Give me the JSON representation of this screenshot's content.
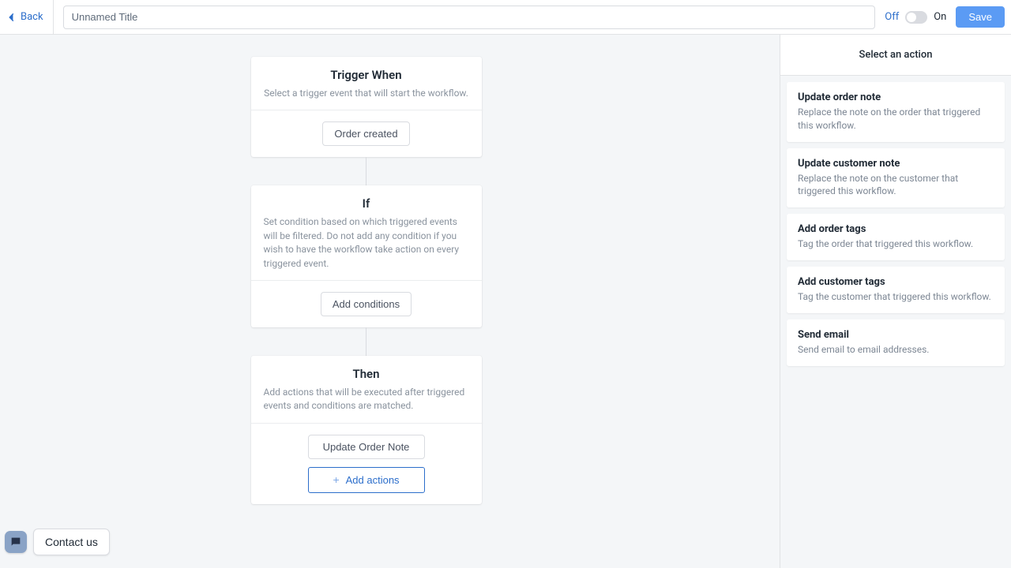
{
  "header": {
    "back_label": "Back",
    "title_value": "Unnamed Title",
    "off_label": "Off",
    "on_label": "On",
    "save_label": "Save"
  },
  "trigger": {
    "title": "Trigger When",
    "subtitle": "Select a trigger event that will start the workflow.",
    "button": "Order created"
  },
  "condition": {
    "title": "If",
    "subtitle": "Set condition based on which triggered events will be filtered. Do not add any condition if you wish to have the workflow take action on every triggered event.",
    "button": "Add conditions"
  },
  "then": {
    "title": "Then",
    "subtitle": "Add actions that will be executed after triggered events and conditions are matched.",
    "action_chip": "Update Order Note",
    "add_button": "Add actions"
  },
  "sidebar": {
    "title": "Select an action",
    "actions": [
      {
        "title": "Update order note",
        "desc": "Replace the note on the order that triggered this workflow."
      },
      {
        "title": "Update customer note",
        "desc": "Replace the note on the customer that triggered this workflow."
      },
      {
        "title": "Add order tags",
        "desc": "Tag the order that triggered this workflow."
      },
      {
        "title": "Add customer tags",
        "desc": "Tag the customer that triggered this workflow."
      },
      {
        "title": "Send email",
        "desc": "Send email to email addresses."
      }
    ]
  },
  "footer": {
    "contact_label": "Contact us"
  }
}
